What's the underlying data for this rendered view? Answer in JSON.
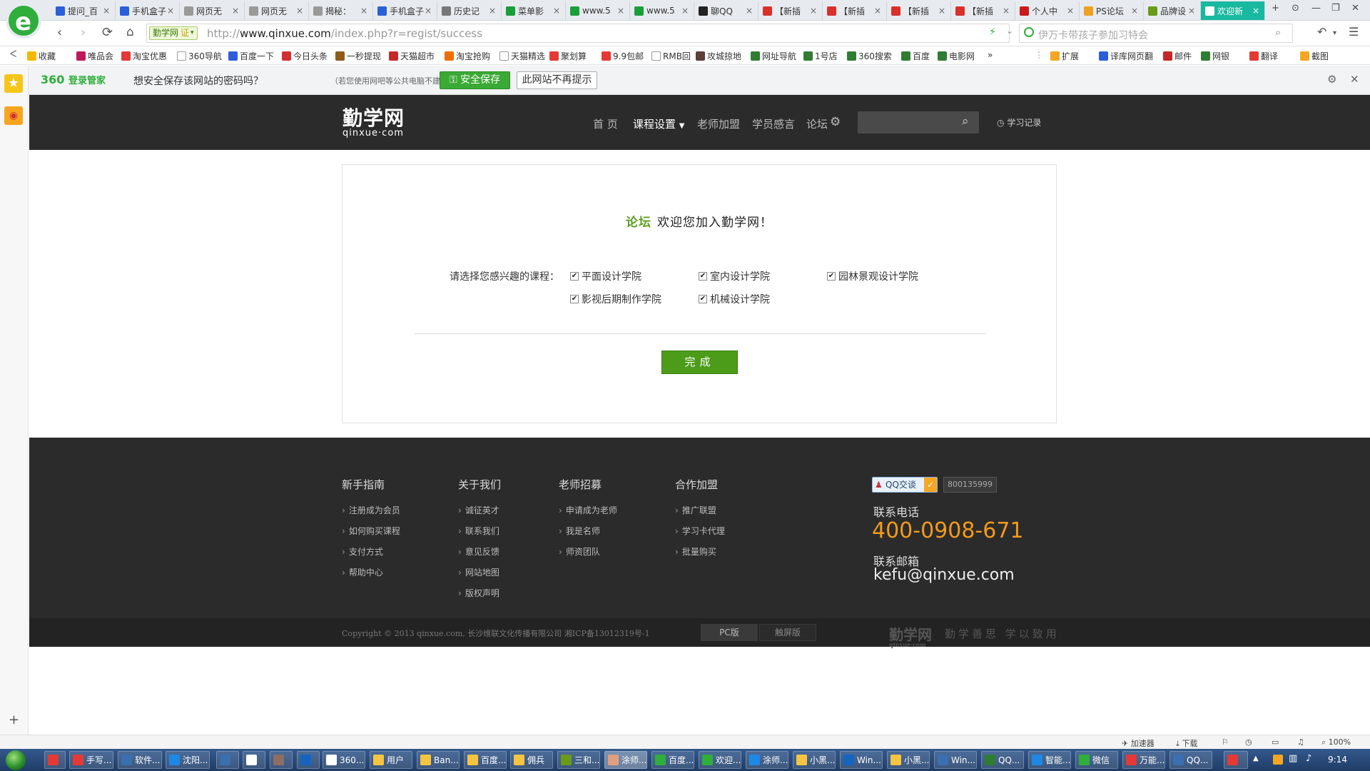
{
  "browser": {
    "logo_letter": "e",
    "tabs": [
      {
        "label": "提问_百",
        "icon_color": "#2b5fd9"
      },
      {
        "label": "手机盒子",
        "icon_color": "#2b5fd9"
      },
      {
        "label": "网页无",
        "icon_color": "#999999"
      },
      {
        "label": "网页无",
        "icon_color": "#999999"
      },
      {
        "label": "揭秘：",
        "icon_color": "#999999"
      },
      {
        "label": "手机盒子",
        "icon_color": "#2b5fd9"
      },
      {
        "label": "历史记",
        "icon_color": "#777777"
      },
      {
        "label": "菜单影",
        "icon_color": "#1a9e3a"
      },
      {
        "label": "www.5",
        "icon_color": "#1a9e3a"
      },
      {
        "label": "www.5",
        "icon_color": "#1a9e3a"
      },
      {
        "label": "聊QQ",
        "icon_color": "#222222"
      },
      {
        "label": "【新插",
        "icon_color": "#d9302c"
      },
      {
        "label": "【新插",
        "icon_color": "#d9302c"
      },
      {
        "label": "【新插",
        "icon_color": "#d9302c"
      },
      {
        "label": "【新插",
        "icon_color": "#d9302c"
      },
      {
        "label": "个人中",
        "icon_color": "#c81a1a"
      },
      {
        "label": "PS论坛",
        "icon_color": "#f0a020"
      },
      {
        "label": "品牌设",
        "icon_color": "#6a9a1a"
      },
      {
        "label": "欢迎新",
        "icon_color": "#ffffff",
        "active": true
      }
    ],
    "new_tab_symbol": "+",
    "window_controls": [
      "⊙",
      "—",
      "❐",
      "✕"
    ],
    "close_symbol": "×",
    "site_tag": "勤学网",
    "site_tag_badge": "证",
    "url_prefix": "http://",
    "url_domain": "www.qinxue.com",
    "url_path": "/index.php?r=regist/success",
    "search_placeholder": "伊万卡带孩子参加习特会",
    "bookmarks": [
      {
        "label": "收藏",
        "color": "#f5b800"
      },
      {
        "label": "唯品会",
        "color": "#c2185b"
      },
      {
        "label": "淘宝优惠",
        "color": "#e53935"
      },
      {
        "label": "360导航",
        "color": "#ffffff"
      },
      {
        "label": "百度一下",
        "color": "#2b5fd9"
      },
      {
        "label": "今日头条",
        "color": "#d32f2f"
      },
      {
        "label": "一秒提现",
        "color": "#8d5b1a"
      },
      {
        "label": "天猫超市",
        "color": "#c62828"
      },
      {
        "label": "淘宝抢购",
        "color": "#ef6c00"
      },
      {
        "label": "天猫精选",
        "color": "#ffffff"
      },
      {
        "label": "聚划算",
        "color": "#e53935"
      },
      {
        "label": "9.9包邮",
        "color": "#e53935"
      },
      {
        "label": "RMB回",
        "color": "#ffffff"
      },
      {
        "label": "攻城掠地",
        "color": "#5d4037"
      },
      {
        "label": "网址导航",
        "color": "#2e7d32"
      },
      {
        "label": "1号店",
        "color": "#2e7d32"
      },
      {
        "label": "360搜索",
        "color": "#2e7d32"
      },
      {
        "label": "百度",
        "color": "#2e7d32"
      },
      {
        "label": "电影网",
        "color": "#2e7d32"
      }
    ],
    "bookmarks_more": "»",
    "extensions": [
      {
        "label": "扩展",
        "color": "#f5a623"
      },
      {
        "label": "译库网页翻",
        "color": "#2b5fd9"
      },
      {
        "label": "邮件",
        "color": "#c62828"
      },
      {
        "label": "网银",
        "color": "#2e7d32"
      },
      {
        "label": "翻译",
        "color": "#e53935"
      },
      {
        "label": "截图",
        "color": "#f5a623"
      }
    ]
  },
  "password_bar": {
    "brand": "360",
    "brand_suffix": "登录管家",
    "message": "想安全保存该网站的密码吗？",
    "hint": "（若您使用网吧等公共电脑不建议保存）",
    "save_label": "安全保存",
    "never_label": "此网站不再提示",
    "settings_symbol": "⚙",
    "close_symbol": "✕"
  },
  "site": {
    "logo_text": "勤学网",
    "logo_sub": "qinxue·com",
    "nav": [
      "首 页",
      "课程设置",
      "老师加盟",
      "学员感言",
      "论坛"
    ],
    "study_record": "学习记录"
  },
  "card": {
    "welcome_prefix": "论坛",
    "welcome_text": "欢迎您加入勤学网！",
    "course_label": "请选择您感兴趣的课程：",
    "courses": [
      "平面设计学院",
      "室内设计学院",
      "园林景观设计学院",
      "影视后期制作学院",
      "机械设计学院"
    ],
    "check_mark": "✔",
    "done_label": "完成"
  },
  "footer": {
    "columns": [
      {
        "title": "新手指南",
        "links": [
          "注册成为会员",
          "如何购买课程",
          "支付方式",
          "帮助中心"
        ]
      },
      {
        "title": "关于我们",
        "links": [
          "诚征英才",
          "联系我们",
          "意见反馈",
          "网站地图",
          "版权声明"
        ]
      },
      {
        "title": "老师招募",
        "links": [
          "申请成为老师",
          "我是名师",
          "师资团队"
        ]
      },
      {
        "title": "合作加盟",
        "links": [
          "推广联盟",
          "学习卡代理",
          "批量购买"
        ]
      }
    ],
    "qq_label": "QQ交谈",
    "qq_number": "800135999",
    "phone_label": "联系电话",
    "phone": "400-0908-671",
    "email_label": "联系邮箱",
    "email": "kefu@qinxue.com",
    "copyright": "Copyright © 2013 qinxue.com, 长沙维联文化传播有限公司 湘ICP备13012319号-1",
    "pc_label": "PC版",
    "touch_label": "触屏版",
    "logo_text": "勤学网",
    "logo_sub": "qinxue·com",
    "slogan": "勤学善思 学以致用"
  },
  "statusbar": {
    "accelerator": "加速器",
    "download": "下载",
    "zoom": "100%",
    "new_tab_symbol": "+"
  },
  "taskbar": {
    "items": [
      {
        "label": "",
        "color": "#e53935"
      },
      {
        "label": "手写...",
        "color": "#e53935"
      },
      {
        "label": "软件...",
        "color": "#3a6fb0"
      },
      {
        "label": "沈阳...",
        "color": "#1e88e5"
      },
      {
        "label": "",
        "color": "#3a6fb0"
      },
      {
        "label": "",
        "color": "#ffffff"
      },
      {
        "label": "",
        "color": "#8d6e63"
      },
      {
        "label": "",
        "color": "#1565c0"
      },
      {
        "label": "360...",
        "color": "#ffffff"
      },
      {
        "label": "用户",
        "color": "#f5c542"
      },
      {
        "label": "Ban...",
        "color": "#f5c542"
      },
      {
        "label": "百度...",
        "color": "#f5c542"
      },
      {
        "label": "佣兵",
        "color": "#f5c542"
      },
      {
        "label": "三和...",
        "color": "#6a9a1a"
      },
      {
        "label": "涂师...",
        "color": "#e0a080",
        "active": true
      },
      {
        "label": "百度...",
        "color": "#2fae3b"
      },
      {
        "label": "欢迎...",
        "color": "#2fae3b"
      },
      {
        "label": "涂师...",
        "color": "#1e88e5"
      },
      {
        "label": "小黑...",
        "color": "#f5c542"
      },
      {
        "label": "Win...",
        "color": "#1565c0"
      },
      {
        "label": "小黑...",
        "color": "#f5c542"
      },
      {
        "label": "Win...",
        "color": "#3a6fb0"
      },
      {
        "label": "QQ...",
        "color": "#2e7d32"
      },
      {
        "label": "智能...",
        "color": "#1e88e5"
      },
      {
        "label": "微信",
        "color": "#2fae3b"
      },
      {
        "label": "万能...",
        "color": "#e53935"
      },
      {
        "label": "QQ...",
        "color": "#3a6fb0"
      },
      {
        "label": "",
        "color": "#e53935"
      }
    ],
    "tray_arrow": "▲",
    "clock": "9:14"
  }
}
